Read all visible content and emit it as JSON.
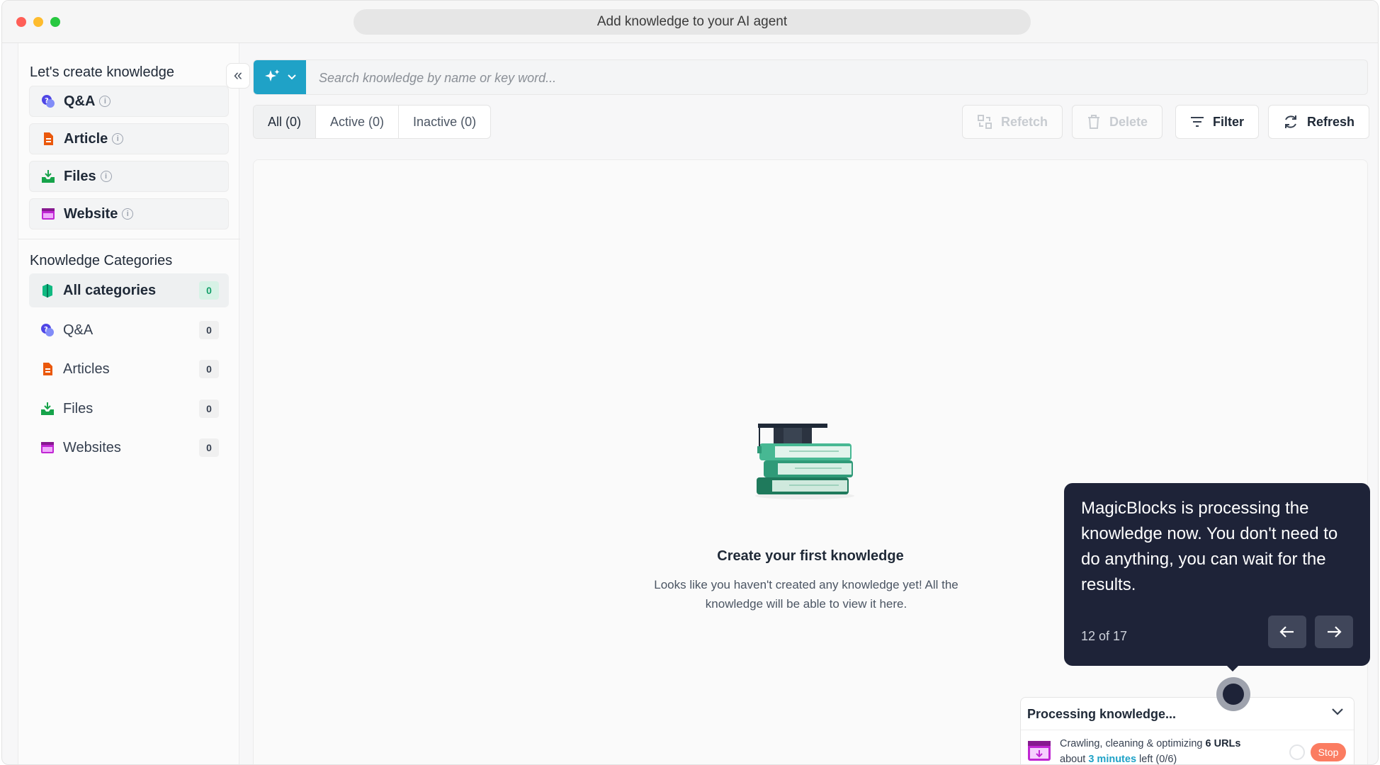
{
  "window": {
    "url_title": "Add knowledge to your AI agent"
  },
  "sidebar": {
    "create_title": "Let's create knowledge",
    "create_items": [
      {
        "label": "Q&A",
        "icon": "qa-icon",
        "color": "#4f46e5"
      },
      {
        "label": "Article",
        "icon": "article-icon",
        "color": "#ea580c"
      },
      {
        "label": "Files",
        "icon": "files-icon",
        "color": "#16a34a"
      },
      {
        "label": "Website",
        "icon": "website-icon",
        "color": "#c026d3"
      }
    ],
    "categories_title": "Knowledge Categories",
    "categories": [
      {
        "label": "All categories",
        "count": "0",
        "icon": "all-categories-icon"
      },
      {
        "label": "Q&A",
        "count": "0",
        "icon": "qa-icon"
      },
      {
        "label": "Articles",
        "count": "0",
        "icon": "article-icon"
      },
      {
        "label": "Files",
        "count": "0",
        "icon": "files-icon"
      },
      {
        "label": "Websites",
        "count": "0",
        "icon": "website-icon"
      }
    ],
    "collapse_icon": "«"
  },
  "search": {
    "placeholder": "Search knowledge by name or key word..."
  },
  "tabs": [
    {
      "label": "All (0)"
    },
    {
      "label": "Active (0)"
    },
    {
      "label": "Inactive (0)"
    }
  ],
  "toolbar": {
    "refetch": "Refetch",
    "delete": "Delete",
    "filter": "Filter",
    "refresh": "Refresh"
  },
  "empty_state": {
    "title": "Create your first knowledge",
    "description": "Looks like you haven't created any knowledge yet! All the knowledge will be able to view it here."
  },
  "tour": {
    "message": "MagicBlocks is processing the knowledge now. You don't need to do anything, you can wait for the results.",
    "step": "12 of 17"
  },
  "processing": {
    "title": "Processing knowledge...",
    "line1_prefix": "Crawling, cleaning & optimizing ",
    "line1_bold": "6 URLs",
    "line2_prefix": "about ",
    "line2_highlight": "3 minutes",
    "line2_suffix": " left (0/6)",
    "stop": "Stop"
  },
  "colors": {
    "accent": "#1fa2c7",
    "tooltip_bg": "#1e2338",
    "stop": "#fb7c61",
    "success": "#16a06b"
  }
}
